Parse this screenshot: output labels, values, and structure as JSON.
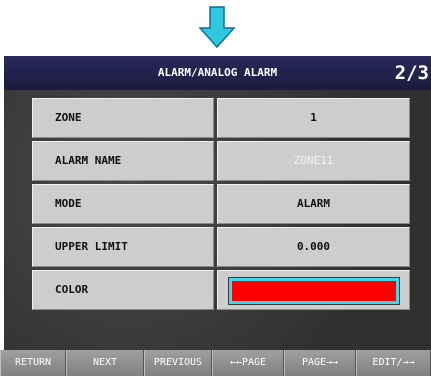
{
  "header": {
    "title": "ALARM/ANALOG ALARM",
    "page": "2/3"
  },
  "rows": [
    {
      "label": "ZONE",
      "value": "1"
    },
    {
      "label": "ALARM NAME",
      "value": "ZONE11"
    },
    {
      "label": "MODE",
      "value": "ALARM"
    },
    {
      "label": "UPPER LIMIT",
      "value": "0.000"
    },
    {
      "label": "COLOR",
      "value": ""
    }
  ],
  "colors": {
    "swatch": "#ff0000",
    "arrow": "#2ec8e0",
    "selection": "#40d8e8"
  },
  "icons": {
    "arrow": "down-arrow-icon"
  },
  "footer": {
    "buttons": [
      "RETURN",
      "NEXT",
      "PREVIOUS",
      "←←PAGE",
      "PAGE→→",
      "EDIT/→→"
    ]
  }
}
